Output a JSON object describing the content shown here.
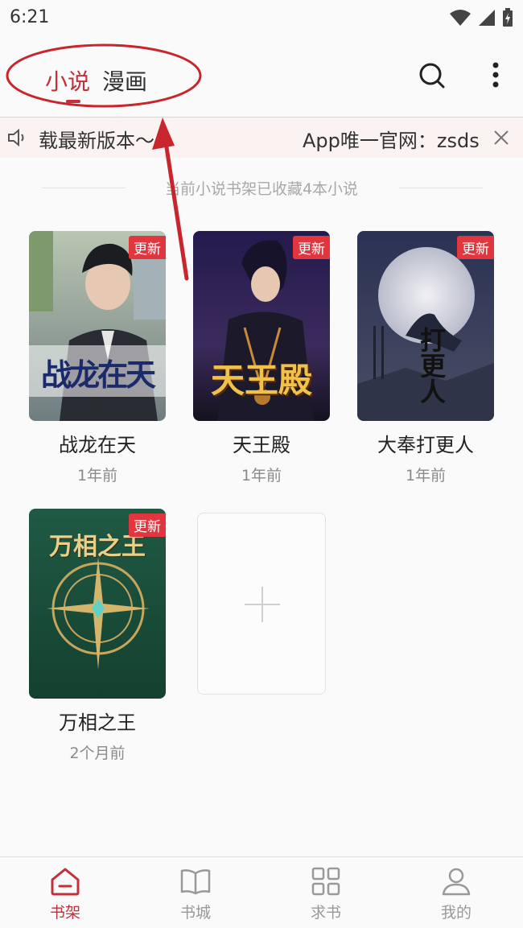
{
  "status_bar": {
    "time": "6:21"
  },
  "header": {
    "tabs": [
      {
        "label": "小说",
        "active": true
      },
      {
        "label": "漫画",
        "active": false
      }
    ]
  },
  "notice": {
    "left_text": "载最新版本～",
    "right_text": "App唯一官网：zsds"
  },
  "shelf": {
    "info": "当前小说书架已收藏4本小说"
  },
  "books": [
    {
      "title": "战龙在天",
      "time": "1年前",
      "badge": "更新",
      "cover_text": "战龙在天"
    },
    {
      "title": "天王殿",
      "time": "1年前",
      "badge": "更新",
      "cover_text": "天王殿"
    },
    {
      "title": "大奉打更人",
      "time": "1年前",
      "badge": "更新",
      "cover_text": "打更人"
    },
    {
      "title": "万相之王",
      "time": "2个月前",
      "badge": "更新",
      "cover_text": "万相之王"
    }
  ],
  "bottom_nav": [
    {
      "label": "书架",
      "icon": "bookshelf-icon",
      "active": true
    },
    {
      "label": "书城",
      "icon": "book-store-icon",
      "active": false
    },
    {
      "label": "求书",
      "icon": "grid-icon",
      "active": false
    },
    {
      "label": "我的",
      "icon": "user-icon",
      "active": false
    }
  ],
  "colors": {
    "accent": "#c2313b",
    "badge": "#e2363f",
    "annotation": "#c8262c"
  }
}
